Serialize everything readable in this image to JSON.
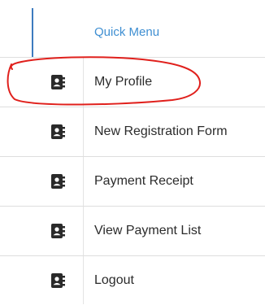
{
  "quick_menu": {
    "header": "Quick Menu",
    "items": [
      {
        "label": "My Profile",
        "icon": "address-book-icon"
      },
      {
        "label": "New Registration Form",
        "icon": "address-book-icon"
      },
      {
        "label": "Payment Receipt",
        "icon": "address-book-icon"
      },
      {
        "label": "View Payment List",
        "icon": "address-book-icon"
      },
      {
        "label": "Logout",
        "icon": "address-book-icon"
      }
    ]
  },
  "colors": {
    "header_text": "#3f8fd2",
    "accent_line": "#3d7bbf",
    "annotation": "#e0201c",
    "icon": "#2a2a2a"
  }
}
